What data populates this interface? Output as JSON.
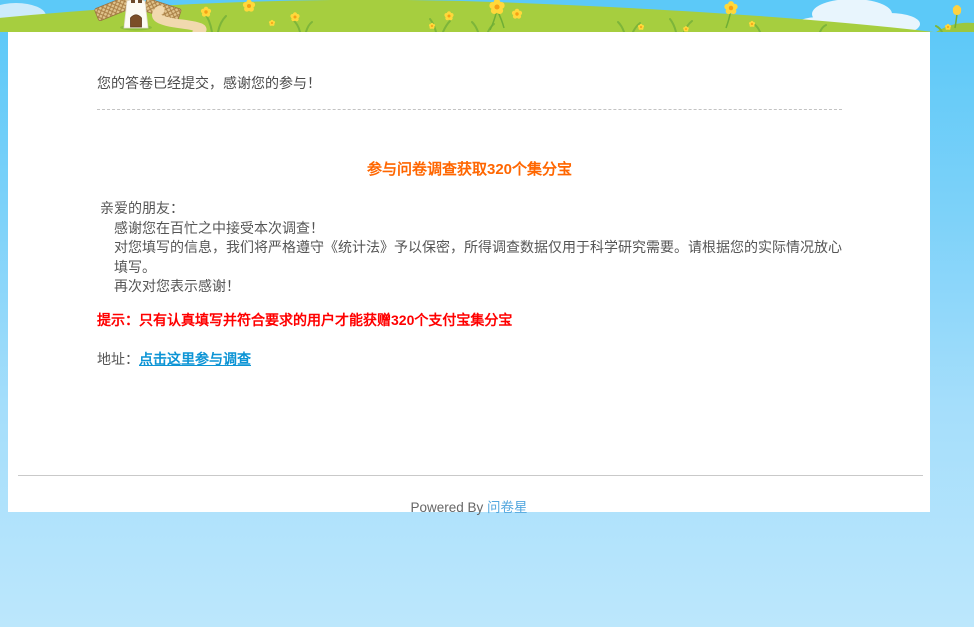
{
  "main": {
    "submitted_message": "您的答卷已经提交，感谢您的参与！",
    "promo": {
      "title": "参与问卷调查获取320个集分宝",
      "greeting": "亲爱的朋友：",
      "lines": [
        "感谢您在百忙之中接受本次调查！",
        "对您填写的信息，我们将严格遵守《统计法》予以保密，所得调查数据仅用于科学研究需要。请根据您的实际情况放心填写。",
        "再次对您表示感谢！"
      ],
      "notice": "提示：只有认真填写并符合要求的用户才能获赠320个支付宝集分宝",
      "address_label": "地址：",
      "link_label": "点击这里参与调查"
    }
  },
  "footer": {
    "powered_by": "Powered By ",
    "brand": "问卷星"
  },
  "colors": {
    "accent_orange": "#ff6600",
    "notice_red": "#ff0000",
    "link_blue": "#0c94d5",
    "brand_blue": "#53a7de",
    "grass_green": "#a6ce3f",
    "sky_blue": "#5cc9f8"
  }
}
